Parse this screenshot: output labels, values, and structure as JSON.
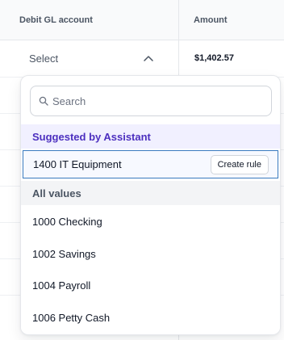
{
  "table": {
    "columns": {
      "debit_gl_account": "Debit GL account",
      "amount": "Amount"
    },
    "row": {
      "select_placeholder": "Select",
      "amount": "$1,402.57"
    }
  },
  "dropdown": {
    "search": {
      "placeholder": "Search"
    },
    "suggested": {
      "heading": "Suggested by Assistant",
      "item": {
        "label": "1400 IT Equipment",
        "action": "Create rule"
      }
    },
    "all_values": {
      "heading": "All values",
      "options": [
        "1000 Checking",
        "1002 Savings",
        "1004 Payroll",
        "1006 Petty Cash"
      ]
    }
  },
  "icons": {
    "search": "search-icon",
    "chevron": "chevron-up-icon"
  },
  "colors": {
    "suggested_heading_background": "#f1f0ff",
    "suggested_heading_text": "#4c2fbf",
    "selected_item_border": "#3a7bbf"
  }
}
